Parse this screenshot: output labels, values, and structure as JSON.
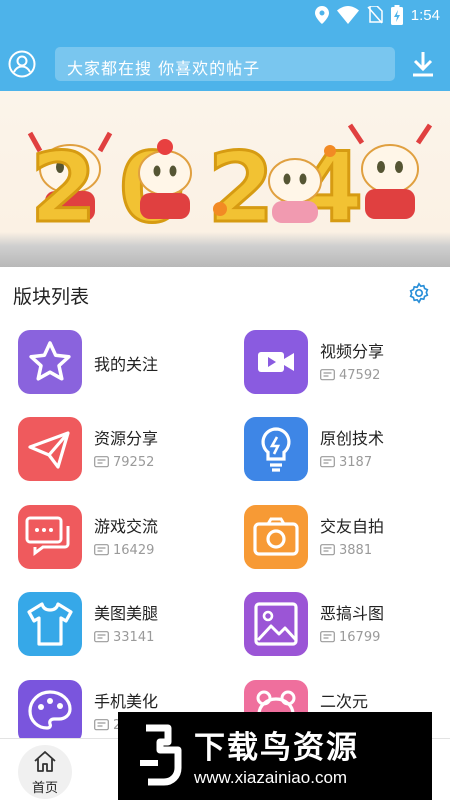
{
  "status_bar": {
    "time": "1:54"
  },
  "header": {
    "search_placeholder": "大家都在搜  你喜欢的帖子",
    "colors": {
      "bar": "#4db3ea"
    }
  },
  "banner": {
    "year_text": "2024"
  },
  "section": {
    "title": "版块列表",
    "boards": [
      {
        "name": "我的关注",
        "count": null,
        "icon": "star-icon",
        "color": "#8a63dd"
      },
      {
        "name": "视频分享",
        "count": "47592",
        "icon": "video-camera-icon",
        "color": "#8a5be0"
      },
      {
        "name": "资源分享",
        "count": "79252",
        "icon": "paper-plane-icon",
        "color": "#ef5a5d"
      },
      {
        "name": "原创技术",
        "count": "3187",
        "icon": "lightbulb-icon",
        "color": "#3e86e6"
      },
      {
        "name": "游戏交流",
        "count": "16429",
        "icon": "chat-bubbles-icon",
        "color": "#ef5a5d"
      },
      {
        "name": "交友自拍",
        "count": "3881",
        "icon": "camera-icon",
        "color": "#f79a35"
      },
      {
        "name": "美图美腿",
        "count": "33141",
        "icon": "tshirt-icon",
        "color": "#36a8e8"
      },
      {
        "name": "恶搞斗图",
        "count": "16799",
        "icon": "picture-icon",
        "color": "#9b55d6"
      },
      {
        "name": "手机美化",
        "count": "2",
        "icon": "palette-icon",
        "color": "#7a55dd"
      },
      {
        "name": "二次元",
        "count": null,
        "icon": "bear-icon",
        "color": "#ef6f9d"
      }
    ]
  },
  "bottom_nav": {
    "home_label": "首页"
  },
  "watermark": {
    "title": "下载鸟资源",
    "url": "www.xiazainiao.com"
  }
}
